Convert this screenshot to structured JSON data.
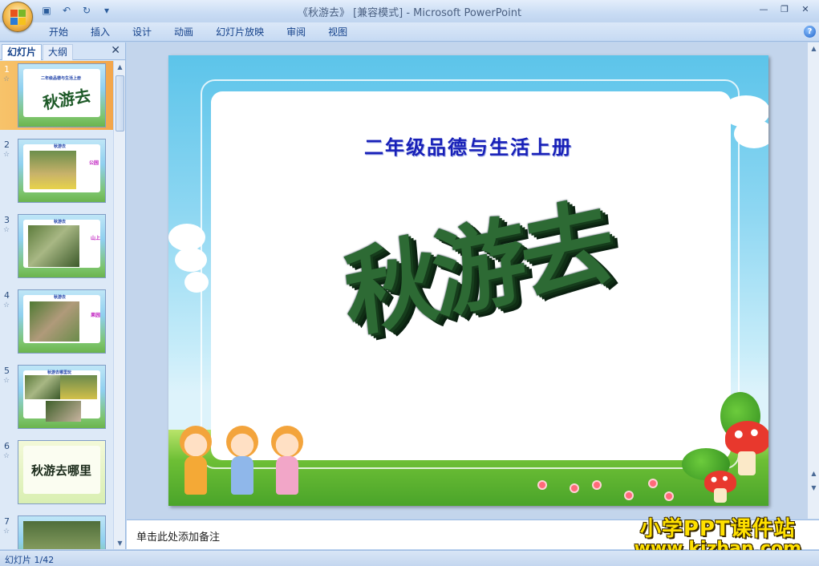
{
  "window": {
    "title": "《秋游去》 [兼容模式] - Microsoft PowerPoint"
  },
  "ribbon": {
    "tabs": [
      "开始",
      "插入",
      "设计",
      "动画",
      "幻灯片放映",
      "审阅",
      "视图"
    ]
  },
  "panel": {
    "tab_slides": "幻灯片",
    "tab_outline": "大纲",
    "thumbnails": [
      {
        "num": "1",
        "caption": "二年级品德与生活上册",
        "big": "秋游去"
      },
      {
        "num": "2",
        "caption": "秋游去",
        "side": "公园"
      },
      {
        "num": "3",
        "caption": "秋游去",
        "side": "山上"
      },
      {
        "num": "4",
        "caption": "秋游去",
        "side": "果园"
      },
      {
        "num": "5",
        "caption": "秋游去哪里玩",
        "side": ""
      },
      {
        "num": "6",
        "caption": "",
        "big": "秋游去哪里"
      },
      {
        "num": "7",
        "caption": "",
        "side": ""
      }
    ]
  },
  "slide": {
    "subtitle": "二年级品德与生活上册",
    "title": "秋游去"
  },
  "notes": {
    "placeholder": "单击此处添加备注"
  },
  "watermark": {
    "line1": "小学PPT课件站",
    "line2": "www.kjzhan.com"
  },
  "status": {
    "slide_count": "幻灯片 1/42"
  },
  "colors": {
    "accent": "#15428b",
    "selected": "#f3a64b"
  }
}
